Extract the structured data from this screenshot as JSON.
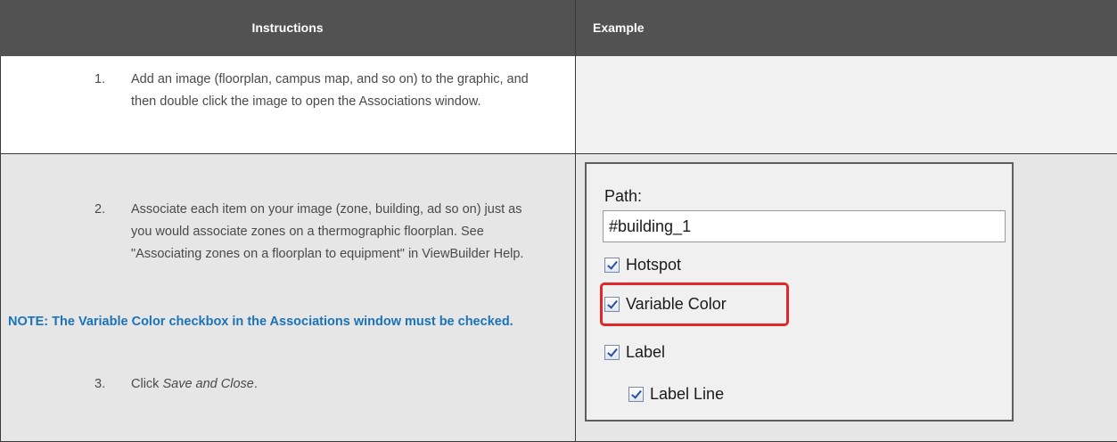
{
  "header": {
    "instructions": "Instructions",
    "example": "Example"
  },
  "rows": [
    {
      "step_number": "1.",
      "step_text": "Add an image (floorplan, campus map, and so on) to the graphic, and then double click the image to open the Associations window."
    },
    {
      "step2_number": "2.",
      "step2_text": "Associate each item on your image (zone, building, ad so on) just as you would associate zones on a thermographic floorplan. See \"Associating zones on a floorplan to equipment\" in ViewBuilder Help.",
      "note": "NOTE: The Variable Color checkbox in the Associations window must be checked.",
      "step3_number": "3.",
      "step3_prefix": "Click ",
      "step3_italic": "Save and Close",
      "step3_suffix": "."
    }
  ],
  "example": {
    "path_label": "Path:",
    "path_value": "#building_1",
    "checkboxes": {
      "hotspot": "Hotspot",
      "variable_color": "Variable Color",
      "label": "Label",
      "label_line": "Label Line"
    },
    "highlight_color": "#e0282b"
  }
}
